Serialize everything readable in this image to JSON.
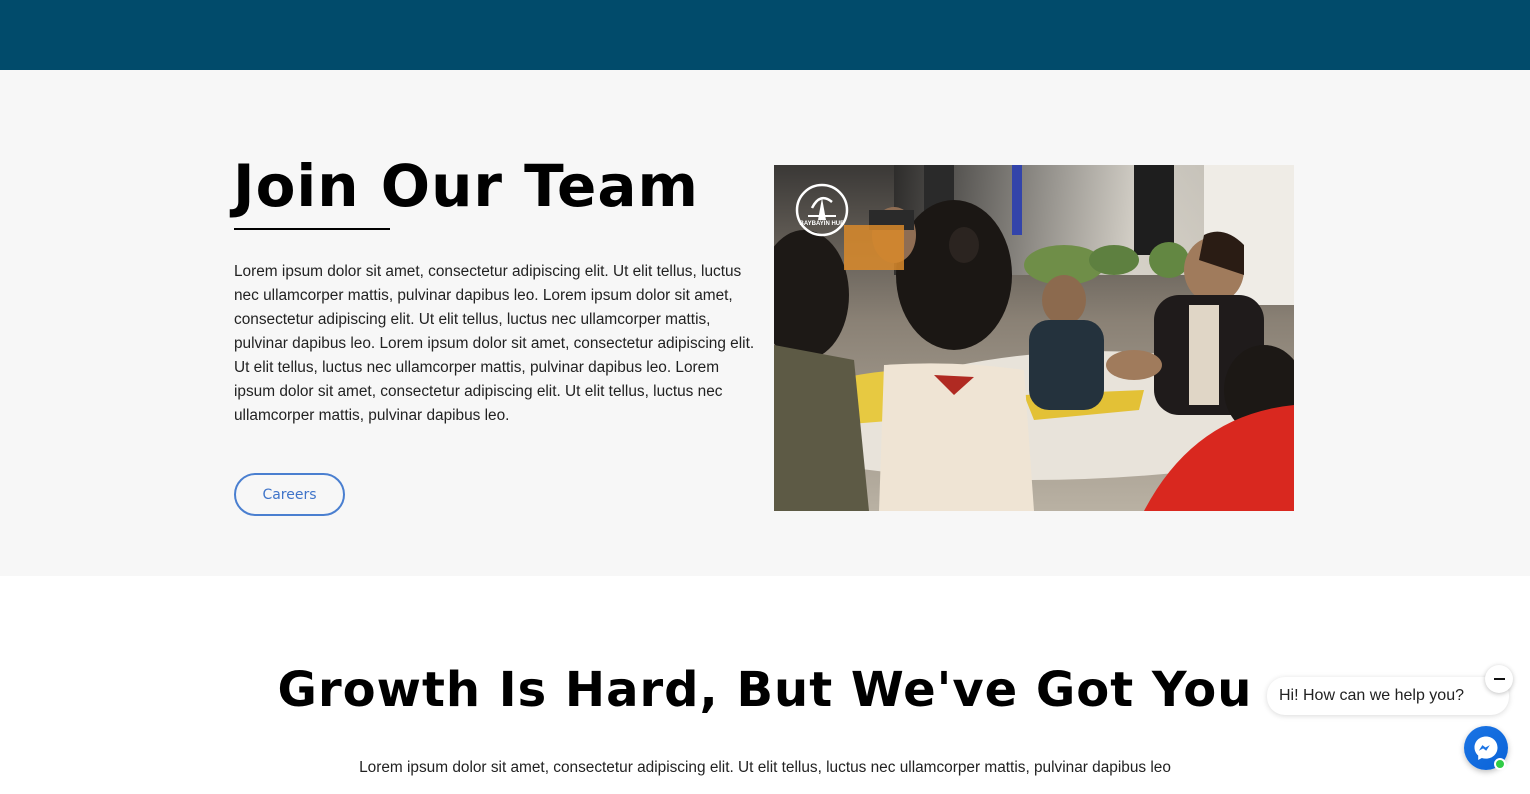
{
  "join": {
    "title": "Join Our Team",
    "paragraph": "Lorem ipsum dolor sit amet, consectetur adipiscing elit. Ut elit tellus, luctus nec ullamcorper mattis, pulvinar dapibus leo. Lorem ipsum dolor sit amet, consectetur adipiscing elit. Ut elit tellus, luctus nec ullamcorper mattis, pulvinar dapibus leo. Lorem ipsum dolor sit amet, consectetur adipiscing elit. Ut elit tellus, luctus nec ullamcorper mattis, pulvinar dapibus leo. Lorem ipsum dolor sit amet, consectetur adipiscing elit. Ut elit tellus, luctus nec ullamcorper mattis, pulvinar dapibus leo.",
    "button_label": "Careers",
    "photo_logo_text": "BAYBAYIN HUB"
  },
  "growth": {
    "title": "Growth Is Hard, But We've Got You",
    "paragraph": "Lorem ipsum dolor sit amet, consectetur adipiscing elit. Ut elit tellus, luctus nec ullamcorper mattis, pulvinar dapibus leo"
  },
  "chat": {
    "greeting": "Hi! How can we help you?",
    "close_icon": "minus-icon",
    "launcher_icon": "messenger-icon"
  },
  "colors": {
    "header": "#014b6b",
    "section_bg": "#f7f7f7",
    "button_border": "#4a7fd0",
    "messenger": "#1b74e4",
    "online": "#31cc46"
  }
}
